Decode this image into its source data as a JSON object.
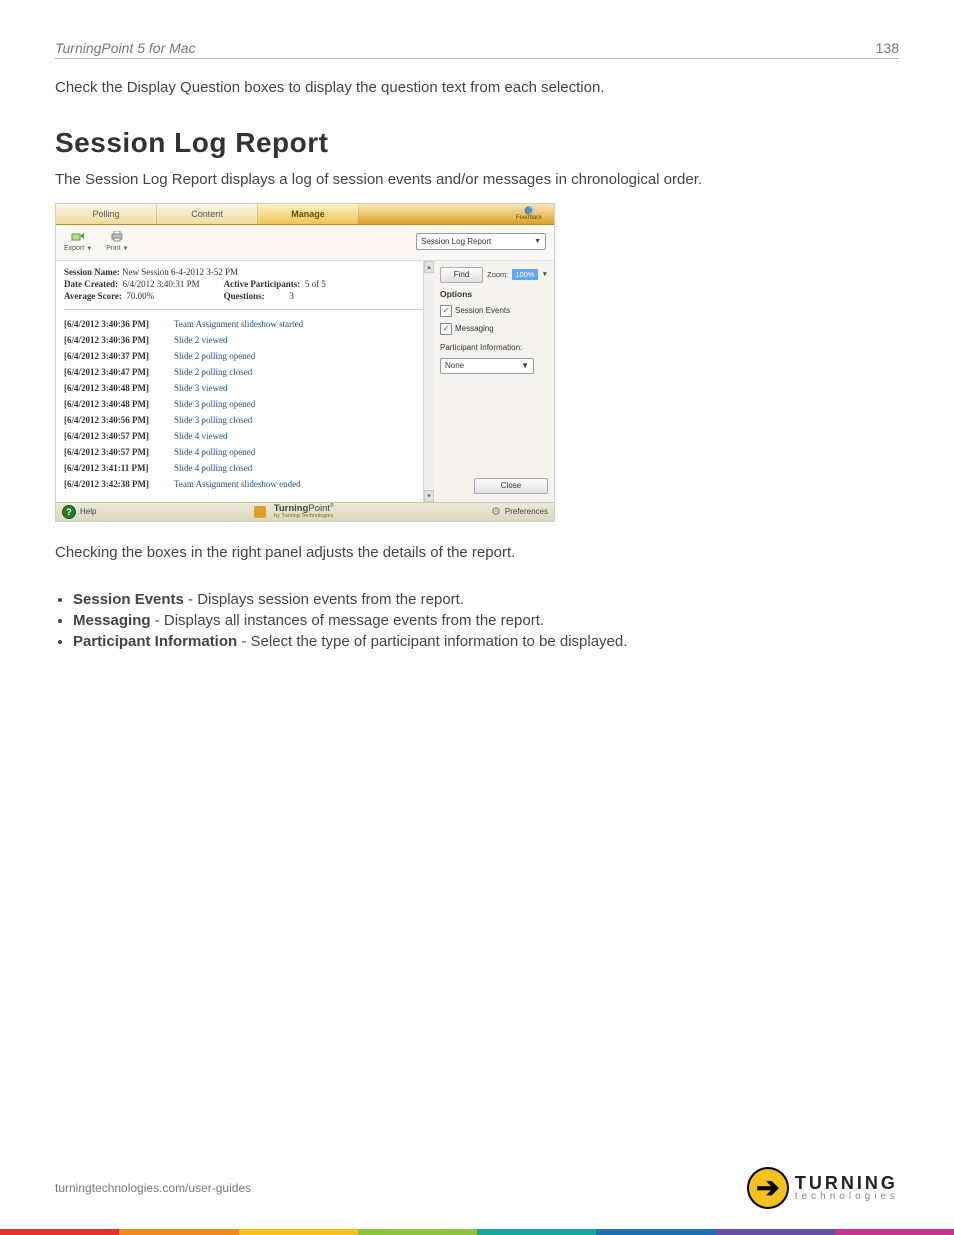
{
  "header": {
    "title": "TurningPoint 5 for Mac",
    "page_number": "138"
  },
  "intro_text": "Check the Display Question boxes to display the question text from each selection.",
  "section_title": "Session Log Report",
  "section_desc": "The Session Log Report displays a log of session events and/or messages in chronological order.",
  "after_text": "Checking the boxes in the right panel adjusts the details of the report.",
  "bullets": [
    {
      "term": "Session Events",
      "desc": " - Displays session events from the report."
    },
    {
      "term": "Messaging",
      "desc": " - Displays all instances of message events from the report."
    },
    {
      "term": "Participant Information",
      "desc": " - Select the type of participant information to be displayed."
    }
  ],
  "shot": {
    "tabs": {
      "polling": "Polling",
      "content": "Content",
      "manage": "Manage",
      "active": "manage"
    },
    "feedback_label": "Feedback",
    "toolbar": {
      "export": "Export",
      "print": "Print",
      "report_dropdown": "Session Log Report"
    },
    "session_meta": {
      "session_name_label": "Session Name:",
      "session_name_value": "New Session 6-4-2012 3-52 PM",
      "date_created_label": "Date Created:",
      "date_created_value": "6/4/2012 3:40:31 PM",
      "avg_score_label": "Average Score:",
      "avg_score_value": "70.00%",
      "active_participants_label": "Active Participants:",
      "active_participants_value": "5 of 5",
      "questions_label": "Questions:",
      "questions_value": "3"
    },
    "log": [
      {
        "ts": "[6/4/2012 3:40:36 PM]",
        "ev": "Team Assignment slideshow started"
      },
      {
        "ts": "[6/4/2012 3:40:36 PM]",
        "ev": "Slide 2 viewed"
      },
      {
        "ts": "[6/4/2012 3:40:37 PM]",
        "ev": "Slide 2 polling opened"
      },
      {
        "ts": "[6/4/2012 3:40:47 PM]",
        "ev": "Slide 2 polling closed"
      },
      {
        "ts": "[6/4/2012 3:40:48 PM]",
        "ev": "Slide 3 viewed"
      },
      {
        "ts": "[6/4/2012 3:40:48 PM]",
        "ev": "Slide 3 polling opened"
      },
      {
        "ts": "[6/4/2012 3:40:56 PM]",
        "ev": "Slide 3 polling closed"
      },
      {
        "ts": "[6/4/2012 3:40:57 PM]",
        "ev": "Slide 4 viewed"
      },
      {
        "ts": "[6/4/2012 3:40:57 PM]",
        "ev": "Slide 4 polling opened"
      },
      {
        "ts": "[6/4/2012 3:41:11 PM]",
        "ev": "Slide 4 polling closed"
      },
      {
        "ts": "[6/4/2012 3:42:38 PM]",
        "ev": "Team Assignment slideshow ended"
      }
    ],
    "sidebar": {
      "find": "Find",
      "zoom_label": "Zoom:",
      "zoom_value": "100%",
      "options_label": "Options",
      "session_events": "Session Events",
      "messaging": "Messaging",
      "participant_info_label": "Participant Information:",
      "participant_info_value": "None",
      "close": "Close"
    },
    "status": {
      "help": "Help",
      "brand_main": "TurningPoint",
      "brand_sub": "by Turning Technologies",
      "preferences": "Preferences"
    }
  },
  "footer": {
    "url": "turningtechnologies.com/user-guides",
    "logo_big": "TURNING",
    "logo_small": "technologies"
  }
}
